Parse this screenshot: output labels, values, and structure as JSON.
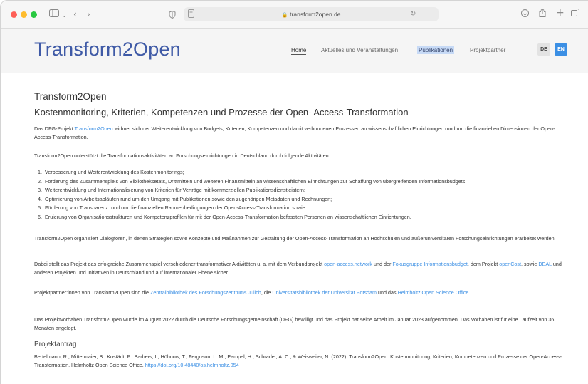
{
  "browser": {
    "url": "transform2open.de"
  },
  "site": {
    "logo": "Transform2Open",
    "nav": [
      {
        "label": "Home"
      },
      {
        "label": "Aktuelles und Veranstaltungen"
      },
      {
        "label": "Publikationen"
      },
      {
        "label": "Projektpartner"
      }
    ],
    "lang": {
      "de": "DE",
      "en": "EN"
    }
  },
  "main": {
    "title": "Transform2Open",
    "subtitle": "Kostenmonitoring, Kriterien, Kompetenzen und Prozesse der Open- Access-Transformation",
    "intro": {
      "pre": "Das DFG-Projekt ",
      "link": "Transform2Open",
      "post": " widmet sich der Weiterentwicklung von Budgets, Kriterien, Kompetenzen und damit verbundenen Prozessen an wissenschaftlichen Einrichtungen rund um die finanziellen Dimensionen der Open-Access-Transformation."
    },
    "support": "Transform2Open unterstützt die Transformationsaktivitäten an Forschungseinrichtungen in Deutschland durch folgende Aktivitäten:",
    "list": [
      {
        "num": "1.",
        "text": "Verbesserung und Weiterentwicklung des Kostenmonitorings;"
      },
      {
        "num": "2.",
        "text": "Förderung des Zusammenspiels von Bibliotheksetats, Drittmitteln und weiteren Finanzmitteln an wissenschaftlichen Einrichtungen zur Schaffung von übergreifenden Informationsbudgets;"
      },
      {
        "num": "3.",
        "text": "Weiterentwicklung und Internationalisierung von Kriterien für Verträge mit kommerziellen Publikationsdienstleistern;"
      },
      {
        "num": "4.",
        "text": "Optimierung von Arbeitsabläufen rund um den Umgang mit Publikationen sowie den zugehörigen Metadaten und Rechnungen;"
      },
      {
        "num": "5.",
        "text": "Förderung von Transparenz rund um die finanziellen Rahmenbedingungen der Open-Access-Transformation sowie"
      },
      {
        "num": "6.",
        "text": "Eruierung von Organisationsstrukturen und Kompetenzprofilen für mit der Open-Access-Transformation befassten Personen an wissenschaftlichen Einrichtungen."
      }
    ],
    "dialog": "Transform2Open organisiert Dialogforen, in denen Strategien sowie Konzepte und Maßnahmen zur Gestaltung der Open-Access-Transformation an Hochschulen und außeruniversitären Forschungseinrichtungen erarbeitet werden.",
    "interplay": {
      "t1": "Dabei stellt das Projekt das erfolgreiche Zusammenspiel verschiedener transformativer Aktivitäten u. a. mit dem Verbundprojekt ",
      "l1": "open-access.network",
      "t2": " und der ",
      "l2": "Fokusgruppe Informationsbudget",
      "t3": ", dem Projekt ",
      "l3": "openCost",
      "t4": ", sowie ",
      "l4": "DEAL",
      "t5": " und anderen Projekten und Initiativen in Deutschland und auf internationaler Ebene sicher."
    },
    "partners": {
      "t1": "Projektpartner:innen von Transform2Open sind die ",
      "l1": "Zentralbibliothek des Forschungszentrums Jülich",
      "t2": ", die ",
      "l2": "Universitätsbibliothek der Universität Potsdam",
      "t3": " und das ",
      "l3": "Helmholtz Open Science Office",
      "t4": "."
    },
    "funding": "Das Projektvorhaben Transform2Open wurde im August 2022 durch die Deutsche Forschungsgemeinschaft (DFG) bewilligt und das Projekt hat seine Arbeit im Januar 2023 aufgenommen. Das Vorhaben ist für eine Laufzeit von 36 Monaten angelegt.",
    "proposal_heading": "Projektantrag",
    "citation": {
      "text": "Bertelmann, R., Mittermaier, B., Kostädt, P., Barbers, I., Höhnow, T., Ferguson, L. M., Pampel, H., Schrader, A. C., & Weisweiler, N. (2022). Transform2Open. Kostenmonitoring, Kriterien, Kompetenzen und Prozesse der Open-Access-Transformation. Helmholtz Open Science Office. ",
      "doi": "https://doi.org/10.48440/os.helmholtz.054"
    }
  }
}
